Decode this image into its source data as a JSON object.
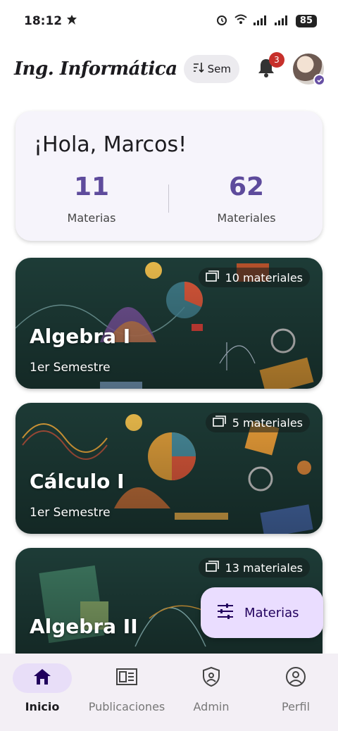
{
  "status_bar": {
    "time": "18:12",
    "battery": "85"
  },
  "app_bar": {
    "title": "Ing. Informática",
    "semester_chip": "Sem",
    "notification_count": "3"
  },
  "welcome": {
    "greeting": "¡Hola, Marcos!",
    "stats": [
      {
        "value": "11",
        "label": "Materias"
      },
      {
        "value": "62",
        "label": "Materiales"
      }
    ]
  },
  "subjects": [
    {
      "title": "Algebra I",
      "semester": "1er Semestre",
      "materials": "10 materiales"
    },
    {
      "title": "Cálculo I",
      "semester": "1er Semestre",
      "materials": "5 materiales"
    },
    {
      "title": "Algebra II",
      "semester": "",
      "materials": "13 materiales"
    }
  ],
  "fab": {
    "label": "Materias"
  },
  "bottom_nav": [
    {
      "label": "Inicio",
      "icon": "home-icon"
    },
    {
      "label": "Publicaciones",
      "icon": "newspaper-icon"
    },
    {
      "label": "Admin",
      "icon": "shield-icon"
    },
    {
      "label": "Perfil",
      "icon": "account-circle-icon"
    }
  ],
  "colors": {
    "accent": "#5e4b9c",
    "fab_bg": "#eaddff",
    "badge": "#c7302b",
    "card_bg": "#1f3f3a"
  }
}
